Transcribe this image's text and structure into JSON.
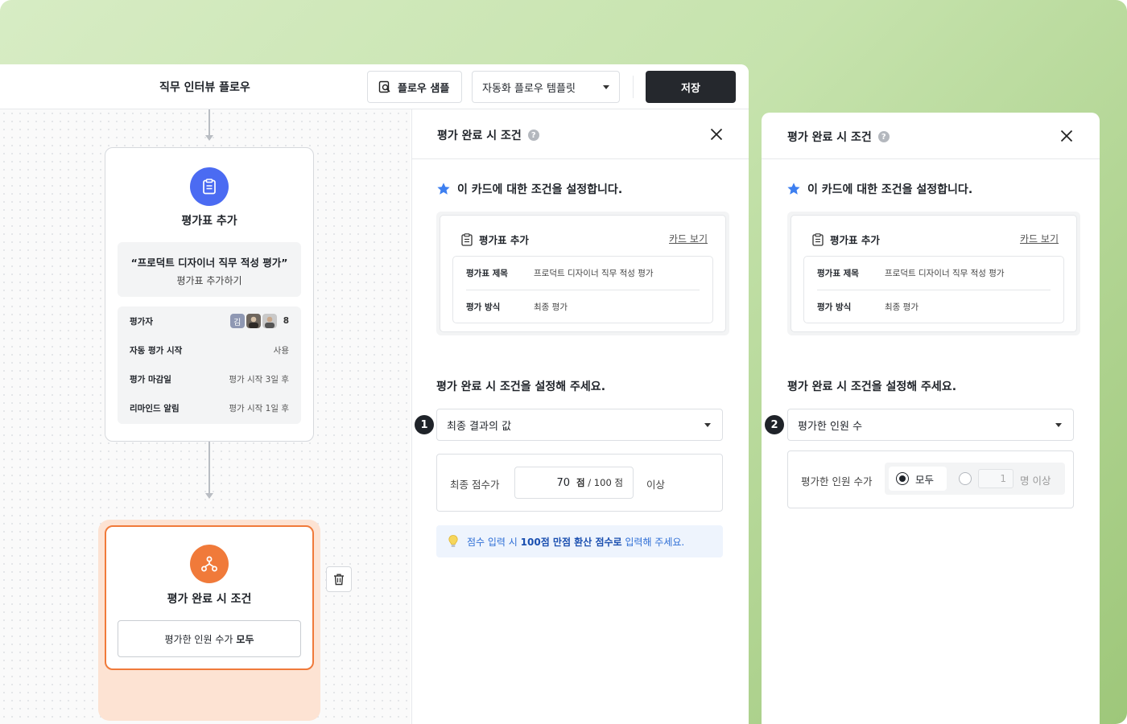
{
  "colors": {
    "background": "#c6e3ad",
    "save_button": "#25282d",
    "node_blue": "#4b6bf2",
    "node_orange": "#f07a3a",
    "star": "#3d7ff0",
    "tip_text": "#2f6fd6"
  },
  "topbar": {
    "flow_title": "직무 인터뷰 플로우",
    "sample_button": "플로우 샘플",
    "sample_icon": "search-document-icon",
    "template_select": "자동화 플로우 템플릿",
    "save_button": "저장"
  },
  "canvas": {
    "eval_node": {
      "icon": "clipboard-icon",
      "title": "평가표 추가",
      "quote_title": "“프로덕트 디자이너 직무 적성 평가”",
      "quote_sub": "평가표 추가하기",
      "meta": [
        {
          "label": "평가자",
          "value": "8"
        },
        {
          "label": "자동 평가 시작",
          "value": "사용"
        },
        {
          "label": "평가 마감일",
          "value": "평가 시작 3일 후"
        },
        {
          "label": "리마인드 알림",
          "value": "평가 시작 1일 후"
        }
      ],
      "avatar_initial": "김"
    },
    "condition_node": {
      "icon": "branch-icon",
      "title": "평가 완료 시 조건",
      "summary_prefix": "평가한 인원 수가",
      "summary_value": "모두"
    }
  },
  "panel_a": {
    "title": "평가 완료 시 조건",
    "help": "?",
    "intro": "이 카드에 대한 조건을 설정합니다.",
    "card_title": "평가표 추가",
    "card_link": "카드 보기",
    "rows": [
      {
        "key": "평가표 제목",
        "value": "프로덕트 디자이너 직무 적성 평가"
      },
      {
        "key": "평가 방식",
        "value": "최종 평가"
      }
    ],
    "question": "평가 완료 시 조건을 설정해 주세요.",
    "step": "1",
    "dropdown": "최종 결과의 값",
    "score_label": "최종 점수가",
    "score_value": "70",
    "score_unit_bold": "점",
    "score_unit_rest": "/ 100 점",
    "score_suffix": "이상",
    "tip_prefix": "점수 입력 시 ",
    "tip_bold": "100점 만점 환산 점수로",
    "tip_suffix": " 입력해 주세요."
  },
  "panel_b": {
    "title": "평가 완료 시 조건",
    "help": "?",
    "intro": "이 카드에 대한 조건을 설정합니다.",
    "card_title": "평가표 추가",
    "card_link": "카드 보기",
    "rows": [
      {
        "key": "평가표 제목",
        "value": "프로덕트 디자이너 직무 적성 평가"
      },
      {
        "key": "평가 방식",
        "value": "최종 평가"
      }
    ],
    "question": "평가 완료 시 조건을 설정해 주세요.",
    "step": "2",
    "dropdown": "평가한 인원 수",
    "eval_label": "평가한 인원 수가",
    "option_all": "모두",
    "count_value": "1",
    "count_suffix": "명 이상"
  }
}
